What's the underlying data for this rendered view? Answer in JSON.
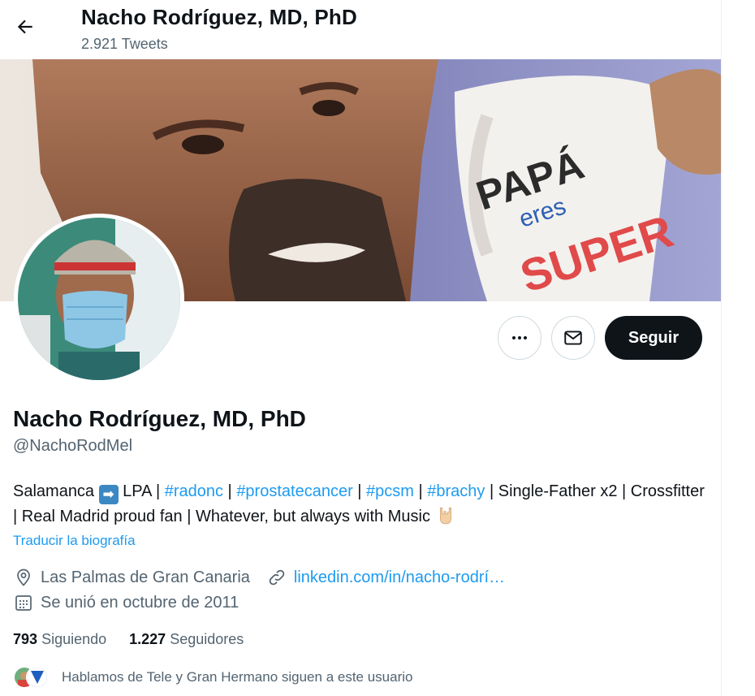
{
  "header": {
    "back_icon": "arrow-left-icon",
    "title": "Nacho Rodríguez, MD, PhD",
    "tweet_count": "2.921 Tweets"
  },
  "actions": {
    "more_icon": "more-dots-icon",
    "message_icon": "envelope-icon",
    "follow_label": "Seguir"
  },
  "profile": {
    "name": "Nacho Rodríguez, MD, PhD",
    "handle": "@NachoRodMel",
    "bio": {
      "part1": "Salamanca",
      "arrow": "➡",
      "part2": " LPA  | ",
      "tag1": "#radonc",
      "sep1": " | ",
      "tag2": "#prostatecancer",
      "sep2": " | ",
      "tag3": "#pcsm",
      "sep3": " | ",
      "tag4": "#brachy",
      "part3": " | Single-Father x2 | Crossfitter | Real Madrid proud fan | Whatever, but always with Music "
    },
    "translate_label": "Traducir la biografía",
    "location": "Las Palmas de Gran Canaria",
    "url": "linkedin.com/in/nacho-rodrí…",
    "joined": "Se unió en octubre de 2011",
    "following_count": "793",
    "following_label": "Siguiendo",
    "followers_count": "1.227",
    "followers_label": "Seguidores",
    "followed_by": "Hablamos de Tele y Gran Hermano siguen a este usuario"
  },
  "colors": {
    "accent": "#1d9bf0",
    "text": "#0f1419",
    "secondary": "#536471",
    "follow_bg": "#0f1419"
  }
}
